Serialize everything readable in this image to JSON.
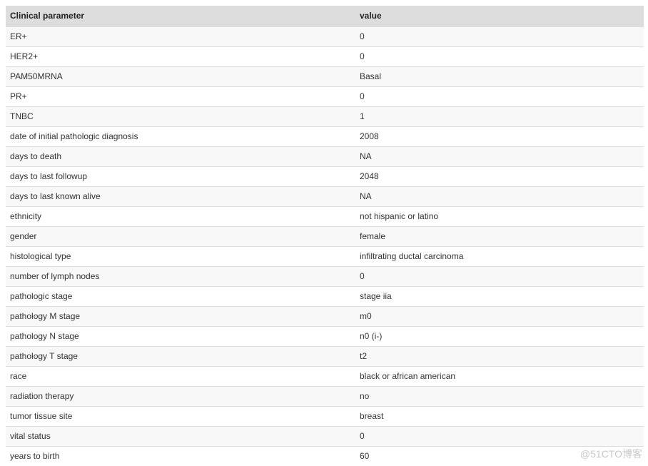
{
  "table": {
    "headers": [
      "Clinical parameter",
      "value"
    ],
    "rows": [
      [
        "ER+",
        "0"
      ],
      [
        "HER2+",
        "0"
      ],
      [
        "PAM50MRNA",
        "Basal"
      ],
      [
        "PR+",
        "0"
      ],
      [
        "TNBC",
        "1"
      ],
      [
        "date of initial pathologic diagnosis",
        "2008"
      ],
      [
        "days to death",
        "NA"
      ],
      [
        "days to last followup",
        "2048"
      ],
      [
        "days to last known alive",
        "NA"
      ],
      [
        "ethnicity",
        "not hispanic or latino"
      ],
      [
        "gender",
        "female"
      ],
      [
        "histological type",
        "infiltrating ductal carcinoma"
      ],
      [
        "number of lymph nodes",
        "0"
      ],
      [
        "pathologic stage",
        "stage iia"
      ],
      [
        "pathology M stage",
        "m0"
      ],
      [
        "pathology N stage",
        "n0 (i-)"
      ],
      [
        "pathology T stage",
        "t2"
      ],
      [
        "race",
        "black or african american"
      ],
      [
        "radiation therapy",
        "no"
      ],
      [
        "tumor tissue site",
        "breast"
      ],
      [
        "vital status",
        "0"
      ],
      [
        "years to birth",
        "60"
      ]
    ]
  },
  "watermark": "@51CTO博客",
  "colors": {
    "header_bg": "#dddddd",
    "row_odd_bg": "#f8f8f8",
    "row_even_bg": "#ffffff",
    "border": "#dddddd"
  }
}
